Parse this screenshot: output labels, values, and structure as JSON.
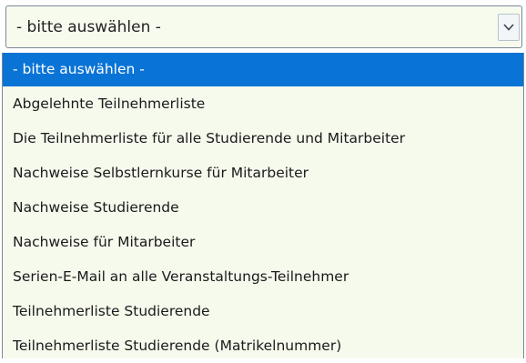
{
  "select": {
    "value": "- bitte auswählen -",
    "arrow_icon": "chevron-down-icon"
  },
  "options": [
    {
      "label": "- bitte auswählen -",
      "selected": true
    },
    {
      "label": "Abgelehnte Teilnehmerliste",
      "selected": false
    },
    {
      "label": "Die Teilnehmerliste für alle Studierende und Mitarbeiter",
      "selected": false
    },
    {
      "label": "Nachweise Selbstlernkurse für Mitarbeiter",
      "selected": false
    },
    {
      "label": "Nachweise Studierende",
      "selected": false
    },
    {
      "label": "Nachweise für Mitarbeiter",
      "selected": false
    },
    {
      "label": "Serien-E-Mail an alle Veranstaltungs-Teilnehmer",
      "selected": false
    },
    {
      "label": "Teilnehmerliste Studierende",
      "selected": false
    },
    {
      "label": "Teilnehmerliste Studierende (Matrikelnummer)",
      "selected": false
    }
  ],
  "colors": {
    "highlight": "#0a74d6",
    "list_background": "#f6faed",
    "select_background": "#f7fbee"
  }
}
